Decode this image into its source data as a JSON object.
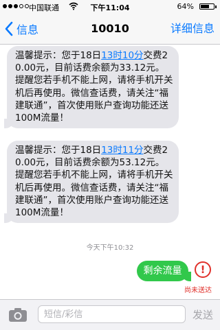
{
  "status_bar": {
    "carrier": "中国联通",
    "time": "下午11:04",
    "battery": "64%",
    "battery_level": 0.64
  },
  "nav": {
    "back_label": "信息",
    "title": "10010",
    "details_label": "详细信息"
  },
  "messages": [
    {
      "direction": "incoming",
      "before_link": "温馨提示：您于18日",
      "link": "13时10分",
      "after_link": "交费20.00元，目前话费余额为33.12元。提醒您若手机不能上网，请将手机开关机后再使用。微信查话费，请关注“福建联通”，首次使用账户查询功能还送100M流量！"
    },
    {
      "direction": "incoming",
      "before_link": "温馨提示：您于18日",
      "link": "13时11分",
      "after_link": "交费20.00元，目前话费余额为53.12元。提醒您若手机不能上网，请将手机开关机后再使用。微信查话费，请关注“福建联通”，首次使用账户查询功能还送100M流量！"
    }
  ],
  "timestamp": "今天下午10:32",
  "outgoing": {
    "text": "剩余流量",
    "error_symbol": "!",
    "status": "尚未送达"
  },
  "input_bar": {
    "placeholder": "短信/彩信",
    "send_label": "发送"
  },
  "colors": {
    "accent": "#0a7aff",
    "incoming_bubble": "#e5e5ea",
    "outgoing_bubble": "#31c84b",
    "error": "#e0302a"
  },
  "icons": [
    "signal-icon",
    "wifi-icon",
    "battery-icon",
    "back-chevron-icon",
    "error-icon",
    "camera-icon"
  ]
}
